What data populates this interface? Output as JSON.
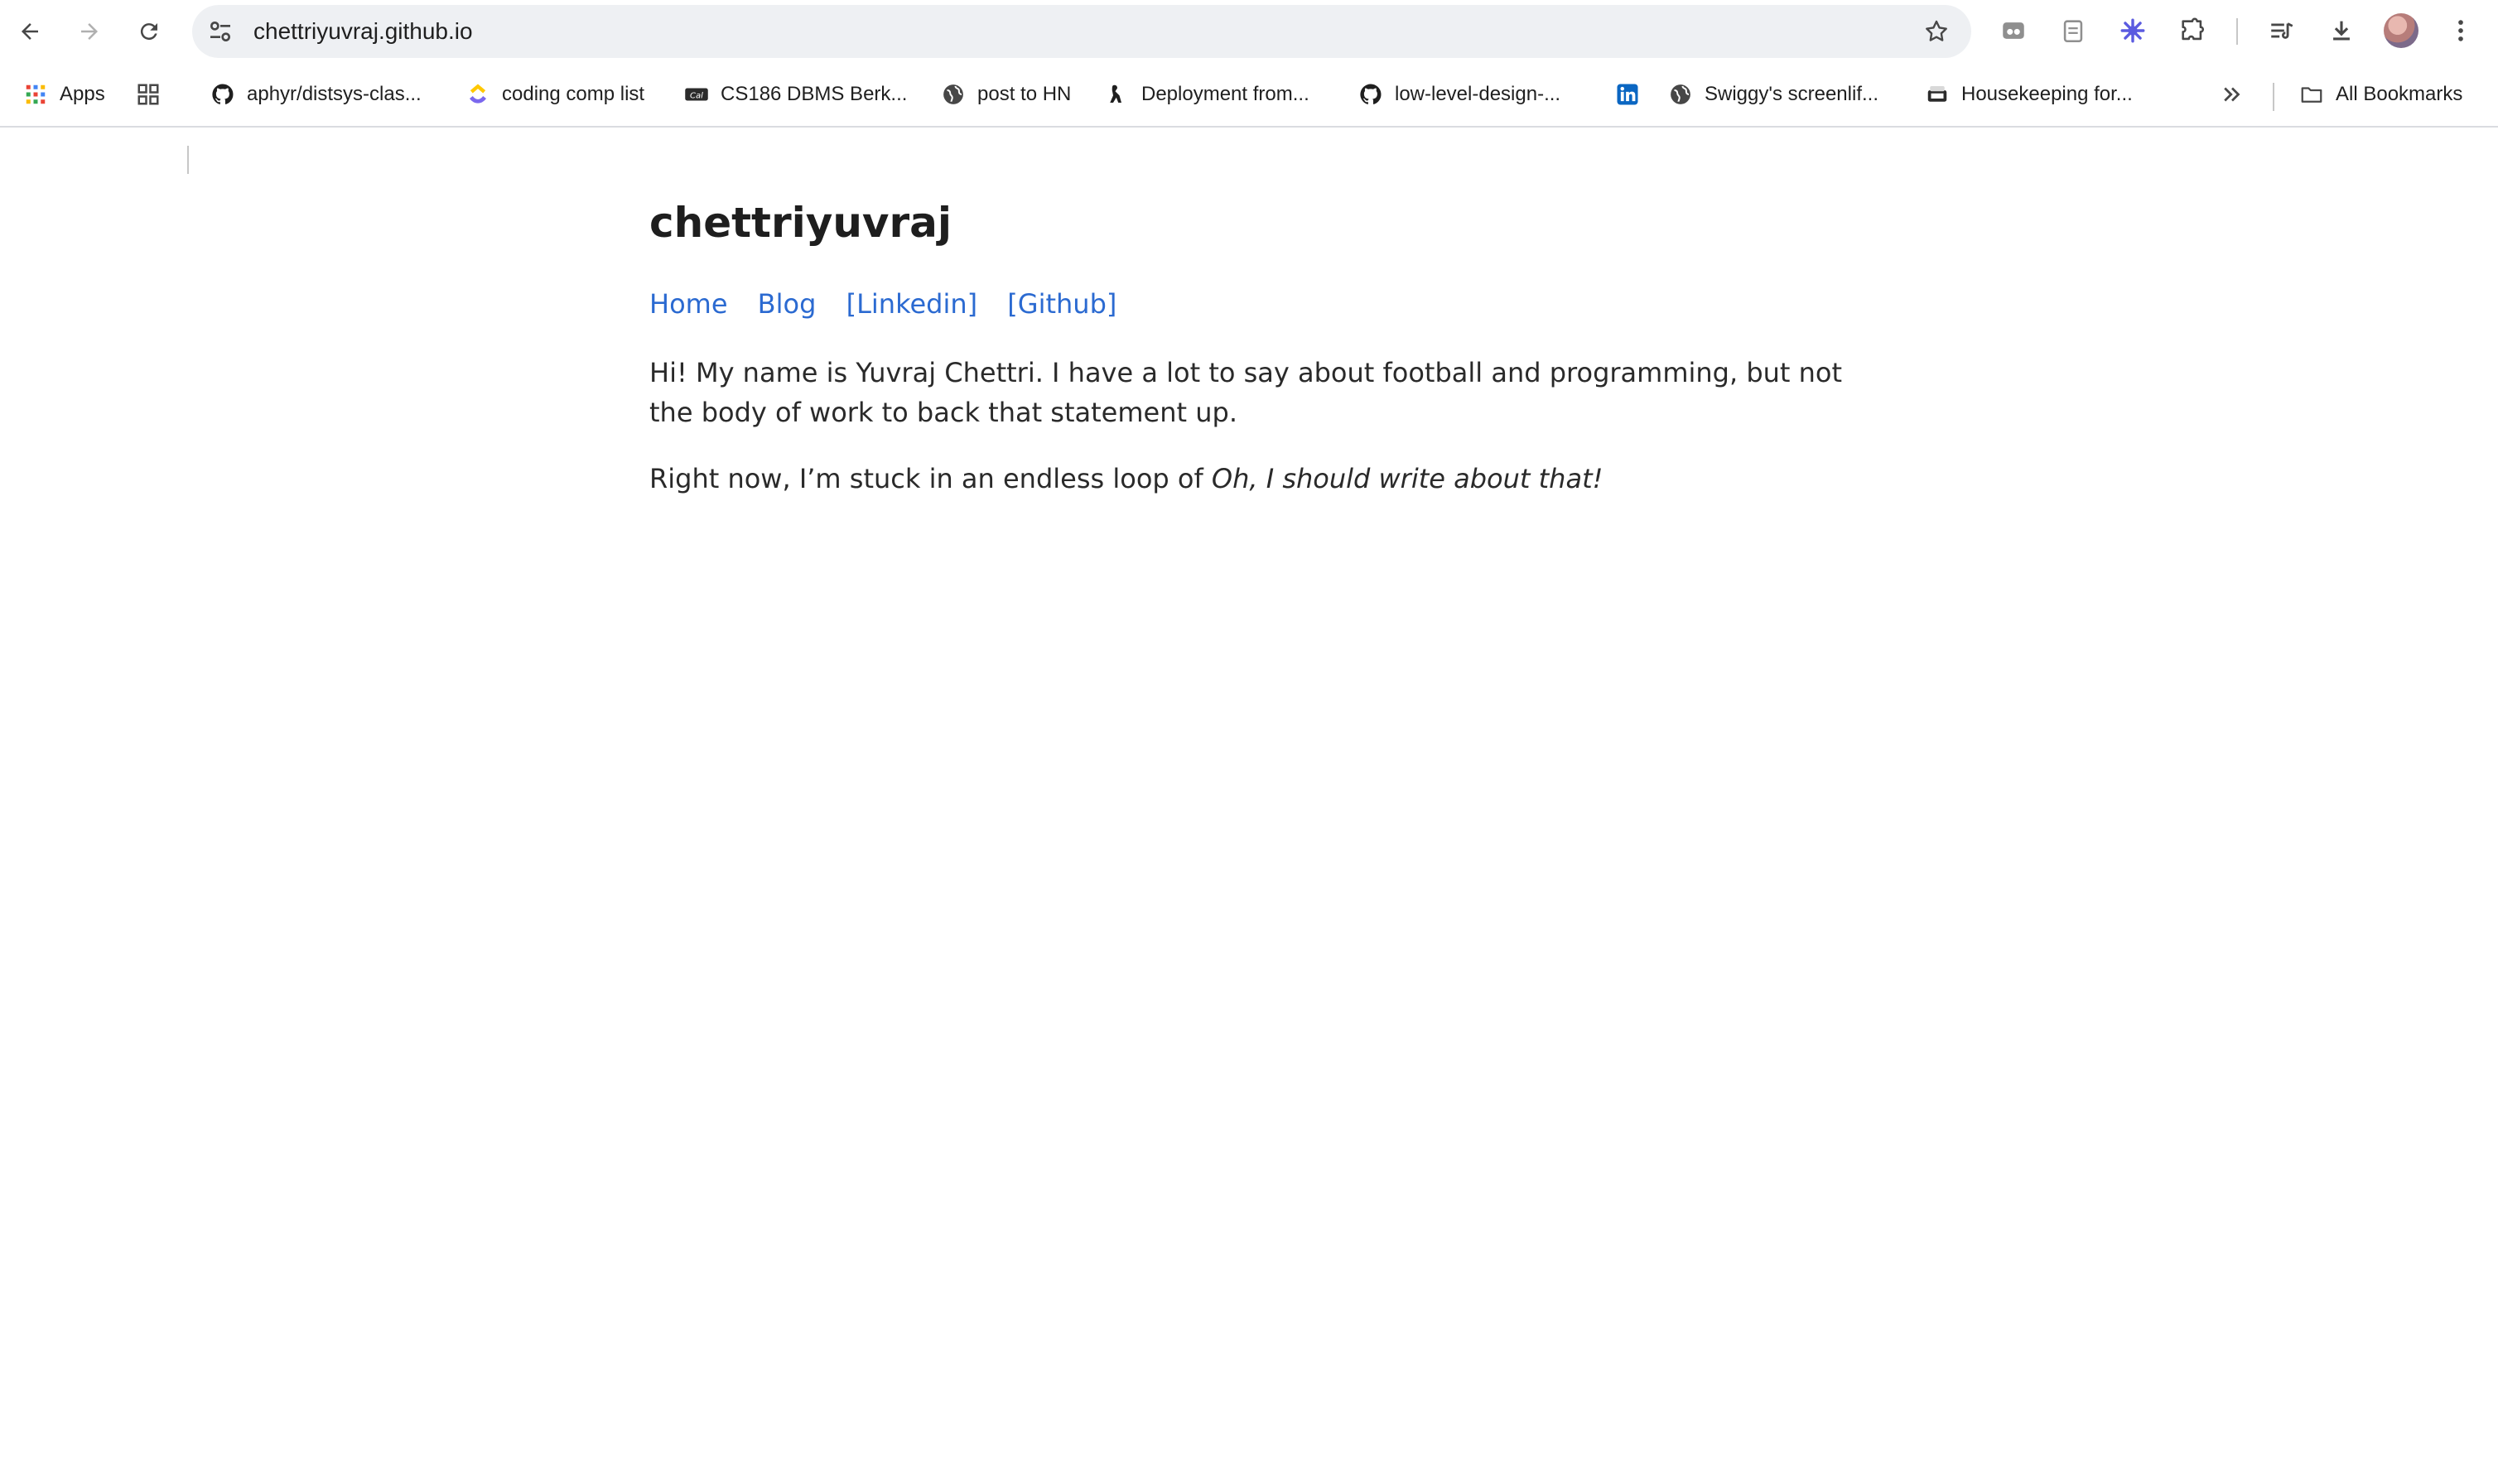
{
  "browser": {
    "url": "chettriyuvraj.github.io",
    "bookmarks": [
      {
        "label": "Apps",
        "icon": "apps-grid-icon"
      },
      {
        "label": "",
        "icon": "tab-groups-icon"
      },
      {
        "label": "aphyr/distsys-clas...",
        "icon": "github-icon"
      },
      {
        "label": "coding comp list",
        "icon": "clickup-icon"
      },
      {
        "label": "CS186 DBMS Berk...",
        "icon": "berkeley-icon"
      },
      {
        "label": "post to HN",
        "icon": "globe-icon"
      },
      {
        "label": "Deployment from...",
        "icon": "deploy-icon"
      },
      {
        "label": "low-level-design-...",
        "icon": "github-icon"
      },
      {
        "label": "",
        "icon": "linkedin-icon"
      },
      {
        "label": "Swiggy's screenlif...",
        "icon": "globe-icon"
      },
      {
        "label": "Housekeeping for...",
        "icon": "notion-icon"
      }
    ],
    "all_bookmarks_label": "All Bookmarks",
    "colors": {
      "link": "#2b6ad1",
      "omnibox_bg": "#eef0f3"
    }
  },
  "page": {
    "site_title": "chettriyuvraj",
    "nav": {
      "home": "Home",
      "blog": "Blog",
      "linkedin": "[Linkedin]",
      "github": "[Github]"
    },
    "intro": "Hi! My name is Yuvraj Chettri. I have a lot to say about football and programming, but not the body of work to back that statement up.",
    "loop_prefix": "Right now, I’m stuck in an endless loop of ",
    "loop_italic": "Oh, I should write about that!"
  }
}
